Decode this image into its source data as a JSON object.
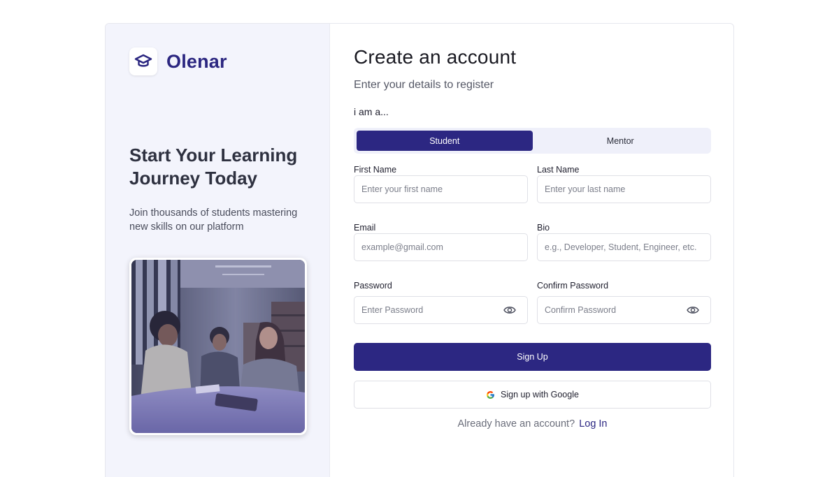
{
  "brand": {
    "name": "Olenar",
    "logo_icon": "graduation-cap-icon",
    "color": "#2b2680"
  },
  "hero": {
    "title": "Start Your Learning Journey Today",
    "subtitle": "Join thousands of students mastering new skills on our platform",
    "image": "students-studying-photo"
  },
  "form": {
    "title": "Create an account",
    "subtitle": "Enter your details to register",
    "role_label": "i am a...",
    "roles": [
      {
        "label": "Student",
        "selected": true
      },
      {
        "label": "Mentor",
        "selected": false
      }
    ],
    "fields": {
      "first_name": {
        "label": "First Name",
        "placeholder": "Enter your first name",
        "value": ""
      },
      "last_name": {
        "label": "Last Name",
        "placeholder": "Enter your last name",
        "value": ""
      },
      "email": {
        "label": "Email",
        "placeholder": "example@gmail.com",
        "value": ""
      },
      "bio": {
        "label": "Bio",
        "placeholder": "e.g., Developer, Student, Engineer, etc.",
        "value": ""
      },
      "password": {
        "label": "Password",
        "placeholder": "Enter Password",
        "value": "",
        "icon": "eye-icon"
      },
      "confirm_password": {
        "label": "Confirm Password",
        "placeholder": "Confirm Password",
        "value": "",
        "icon": "eye-icon"
      }
    },
    "signup_button": "Sign Up",
    "google_button": "Sign up with Google",
    "login_prompt": "Already have an account?",
    "login_link": "Log In"
  },
  "colors": {
    "primary": "#2c2782",
    "panel_bg": "#f3f4fc"
  }
}
